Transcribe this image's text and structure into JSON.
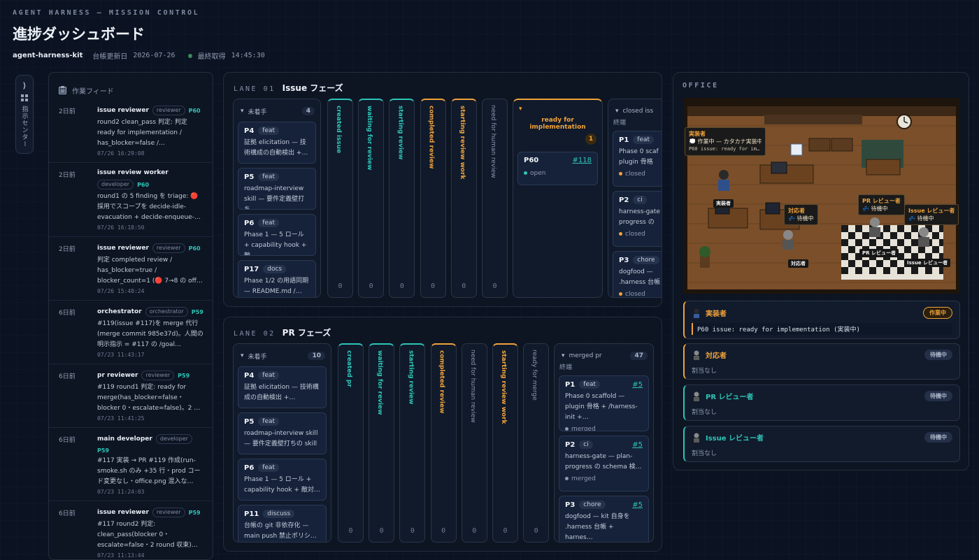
{
  "header": {
    "kicker": "AGENT HARNESS — MISSION CONTROL",
    "title": "進捗ダッシュボード",
    "project": "agent-harness-kit",
    "ledger_label": "台帳更新日",
    "ledger_date": "2026-07-26",
    "fetched_label": "最終取得",
    "fetched_time": "14:45:30"
  },
  "sidebar": {
    "toggle": "⟩",
    "label": "指示センター"
  },
  "feed": {
    "title": "作業フィード",
    "items": [
      {
        "ago": "2日前",
        "actor": "issue reviewer",
        "role": "reviewer",
        "ref": "P60",
        "text": "round2 clean_pass 判定: 判定 ready for implementation / has_blocker=false /…",
        "time": "07/26 16:29:08"
      },
      {
        "ago": "2日前",
        "actor": "issue review worker",
        "role": "developer",
        "ref": "P60",
        "text": "round1 の 5 finding を triage: 🔴 採用でスコープを decide-idle-evacuation + decide-enqueue-…",
        "time": "07/26 16:18:50"
      },
      {
        "ago": "2日前",
        "actor": "issue reviewer",
        "role": "reviewer",
        "ref": "P60",
        "text": "判定 completed review / has_blocker=true / blocker_count=1 (🔴 7→8 の off…",
        "time": "07/26 15:48:24"
      },
      {
        "ago": "6日前",
        "actor": "orchestrator",
        "role": "orchestrator",
        "ref": "P59",
        "text": "#119(issue #117)を merge 代行 (merge commit 985e37d)。人間の明示指示 = #117 の /goal…",
        "time": "07/23 11:43:17"
      },
      {
        "ago": "6日前",
        "actor": "pr reviewer",
        "role": "reviewer",
        "ref": "P59",
        "text": "#119 round1 判定: ready for merge(has_blocker=false・blocker 0・escalate=false)。2 …",
        "time": "07/23 11:41:25"
      },
      {
        "ago": "6日前",
        "actor": "main developer",
        "role": "developer",
        "ref": "P59",
        "text": "#117 実装 → PR #119 作成(run-smoke.sh のみ +35 行・prod コード変更なし・office.png 混入な…",
        "time": "07/23 11:24:03"
      },
      {
        "ago": "6日前",
        "actor": "issue reviewer",
        "role": "reviewer",
        "ref": "P59",
        "text": "#117 round2 判定: clean_pass(blocker 0・escalate=false・2 round 収束)…",
        "time": "07/23 11:13:44"
      }
    ]
  },
  "lanes": {
    "lane1": {
      "no": "LANE 01",
      "name": "Issue フェーズ",
      "todo": {
        "name": "未着手",
        "count": "4",
        "cards": [
          {
            "id": "P4",
            "tag": "feat",
            "text": "証拠 elicitation — 技術構成の自動検出 +…"
          },
          {
            "id": "P5",
            "tag": "feat",
            "text": "roadmap-interview skill — 要件定義壁打ち…"
          },
          {
            "id": "P6",
            "tag": "feat",
            "text": "Phase 1 — 5 ロール + capability hook + 敵…"
          },
          {
            "id": "P17",
            "tag": "docs",
            "text": "Phase 1/2 の用語同期 — README.md /…"
          }
        ]
      },
      "narrow": [
        {
          "label": "created issue",
          "count": "0",
          "tone": "teal"
        },
        {
          "label": "waiting for review",
          "count": "0",
          "tone": "teal"
        },
        {
          "label": "starting review",
          "count": "0",
          "tone": "teal"
        },
        {
          "label": "completed review",
          "count": "0",
          "tone": "amber"
        },
        {
          "label": "starting review work",
          "count": "0",
          "tone": "amber"
        },
        {
          "label": "need for human review",
          "count": "0",
          "tone": "gray"
        }
      ],
      "ready": {
        "name": "ready for implementation",
        "count": "1",
        "card": {
          "id": "P60",
          "link": "#118",
          "status": "open"
        }
      },
      "closed": {
        "name": "closed iss",
        "sub": "終端",
        "cards": [
          {
            "id": "P1",
            "tag": "feat",
            "text": "Phase 0 scaf plugin 骨格",
            "status": "closed"
          },
          {
            "id": "P2",
            "tag": "ci",
            "text": "harness-gate progress の",
            "status": "closed"
          },
          {
            "id": "P3",
            "tag": "chore",
            "text": "dogfood — .harness 台帳",
            "status": "closed"
          }
        ]
      }
    },
    "lane2": {
      "no": "LANE 02",
      "name": "PR フェーズ",
      "todo": {
        "name": "未着手",
        "count": "10",
        "cards": [
          {
            "id": "P4",
            "tag": "feat",
            "text": "証拠 elicitation — 技術構成の自動検出 +…"
          },
          {
            "id": "P5",
            "tag": "feat",
            "text": "roadmap-interview skill — 要件定義壁打ちの skill …"
          },
          {
            "id": "P6",
            "tag": "feat",
            "text": "Phase 1 — 5 ロール + capability hook + 敵対…"
          },
          {
            "id": "P11",
            "tag": "discuss",
            "text": "台帳の git 非依存化 — main push 禁止ポリシ…"
          }
        ]
      },
      "narrow": [
        {
          "label": "created pr",
          "count": "0",
          "tone": "teal"
        },
        {
          "label": "waiting for review",
          "count": "0",
          "tone": "teal"
        },
        {
          "label": "starting review",
          "count": "0",
          "tone": "teal"
        },
        {
          "label": "completed review",
          "count": "0",
          "tone": "amber"
        },
        {
          "label": "need for human review",
          "count": "0",
          "tone": "gray"
        },
        {
          "label": "starting review work",
          "count": "0",
          "tone": "amber"
        },
        {
          "label": "ready for merge",
          "count": "0",
          "tone": "gray"
        }
      ],
      "merged": {
        "name": "merged pr",
        "count": "47",
        "sub": "終端",
        "cards": [
          {
            "id": "P1",
            "tag": "feat",
            "link": "#5",
            "text": "Phase 0 scaffold — plugin 骨格 + /harness-init +…",
            "status": "merged"
          },
          {
            "id": "P2",
            "tag": "ci",
            "link": "#5",
            "text": "harness-gate — plan-progress の schema 検…",
            "status": "merged"
          },
          {
            "id": "P3",
            "tag": "chore",
            "link": "#5",
            "text": "dogfood — kit 自身を .harness 台帳 + harnes…",
            "status": "merged"
          }
        ]
      }
    }
  },
  "office": {
    "title": "OFFICE",
    "scene": {
      "bubble_who": "実装者",
      "bubble_line": "💭 作業中 — カタカナ実装中…",
      "bubble_task": "P60 issue: ready for im…",
      "tags": {
        "impl": "実装者",
        "resp": "対応者",
        "pr": "PR レビュー者",
        "issue": "Issue レビュー者"
      },
      "floating": {
        "resp_name": "対応者",
        "resp_state": "💤 待機中",
        "pr_name": "PR レビュー者",
        "pr_state": "💤 待機中",
        "issue_name": "Issue レビュー者",
        "issue_state": "💤 待機中"
      }
    },
    "agents": [
      {
        "name": "実装者",
        "badge": "作業中",
        "task": "P60 issue: ready for implementation (実装中)"
      },
      {
        "name": "対応者",
        "badge": "待機中",
        "note": "割当なし"
      },
      {
        "name": "PR レビュー者",
        "badge": "待機中",
        "note": "割当なし"
      },
      {
        "name": "Issue レビュー者",
        "badge": "待機中",
        "note": "割当なし"
      }
    ]
  },
  "colors": {
    "teal": "#2ec4b6",
    "amber": "#f0a23b",
    "background": "#0b1322"
  }
}
